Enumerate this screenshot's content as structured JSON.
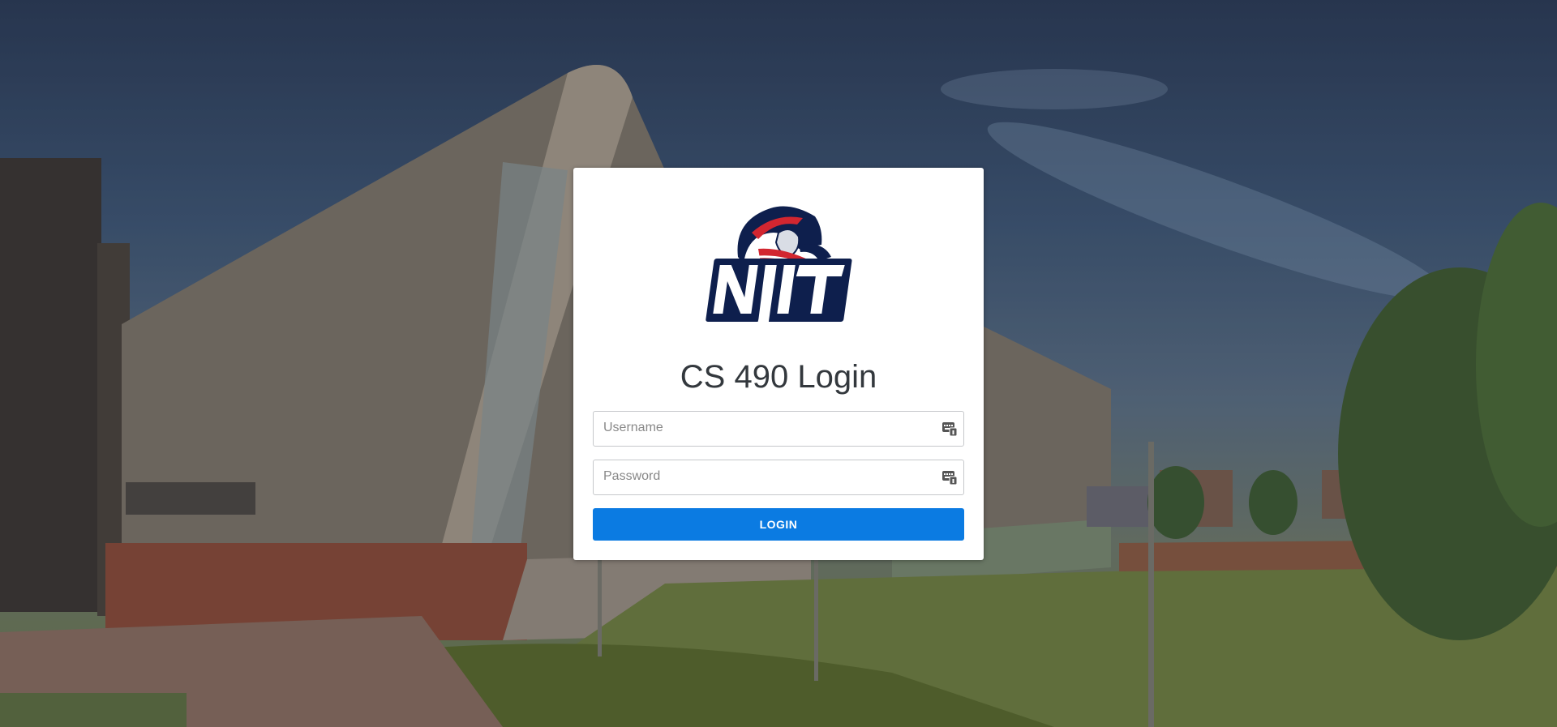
{
  "page": {
    "title": "CS 490 Login"
  },
  "logo": {
    "text": "NJIT",
    "colors": {
      "navy": "#0e1f4d",
      "red": "#d22630",
      "white": "#ffffff"
    }
  },
  "form": {
    "username_placeholder": "Username",
    "username_value": "",
    "password_placeholder": "Password",
    "password_value": "",
    "login_label": "LOGIN"
  },
  "colors": {
    "primary": "#0b7be2",
    "title_text": "#33383d",
    "border": "#c6c8cb"
  },
  "icons": {
    "field_icon": "keyboard-credential-icon"
  }
}
